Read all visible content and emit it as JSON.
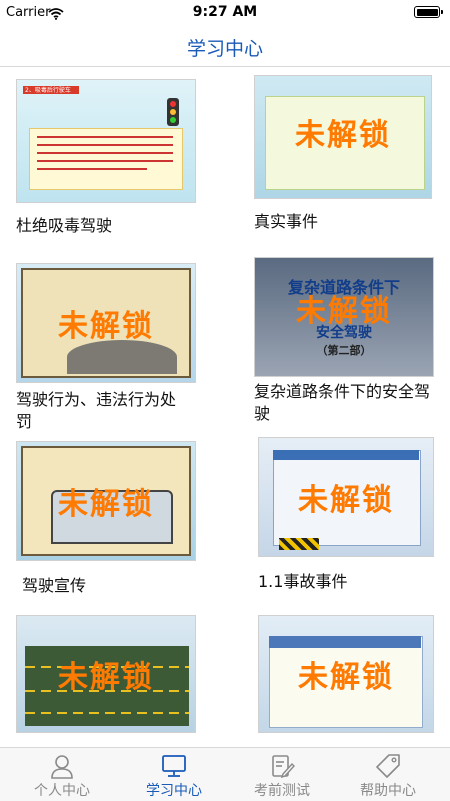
{
  "status_bar": {
    "carrier": "Carrier",
    "time": "9:27 AM"
  },
  "nav": {
    "title": "学习中心"
  },
  "locked_text": "未解锁",
  "cards": [
    {
      "title": "杜绝吸毒驾驶",
      "locked": false,
      "slide_heading": "2、吸毒后行驶车"
    },
    {
      "title": "真实事件",
      "locked": true
    },
    {
      "title": "驾驶行为、违法行为处罚",
      "locked": true
    },
    {
      "title": "复杂道路条件下的安全驾驶",
      "locked": true,
      "slide_heading": "复杂道路条件下",
      "slide_sub": "安全驾驶",
      "slide_part": "（第二部）"
    },
    {
      "title": "驾驶宣传",
      "locked": true
    },
    {
      "title": "1.1事故事件",
      "locked": true
    },
    {
      "title": "",
      "locked": true
    },
    {
      "title": "",
      "locked": true
    }
  ],
  "tabs": [
    {
      "label": "个人中心",
      "icon": "person-icon",
      "active": false
    },
    {
      "label": "学习中心",
      "icon": "monitor-icon",
      "active": true
    },
    {
      "label": "考前测试",
      "icon": "edit-icon",
      "active": false
    },
    {
      "label": "帮助中心",
      "icon": "tag-icon",
      "active": false
    }
  ],
  "colors": {
    "accent": "#1a5bb8",
    "locked": "#ff7a00",
    "inactive_tab": "#8a8a8a"
  }
}
